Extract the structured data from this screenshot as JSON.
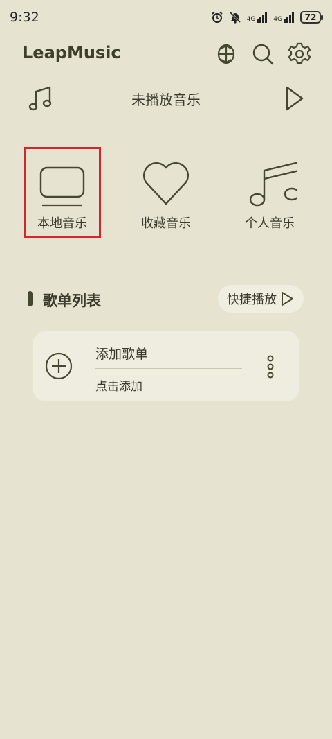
{
  "status_bar": {
    "time": "9:32",
    "network_1": "4G",
    "network_2": "4G",
    "battery": "72",
    "icons": [
      "alarm-icon",
      "mute-icon",
      "signal-icon",
      "signal-icon",
      "battery-icon"
    ]
  },
  "header": {
    "app_title": "LeapMusic",
    "icons": [
      "equalizer-icon",
      "search-icon",
      "settings-gear-icon"
    ]
  },
  "now_playing": {
    "title": "未播放音乐",
    "icons": [
      "music-note-icon",
      "play-icon"
    ]
  },
  "categories": [
    {
      "label": "本地音乐",
      "icon": "local-music-monitor-icon"
    },
    {
      "label": "收藏音乐",
      "icon": "heart-icon"
    },
    {
      "label": "个人音乐",
      "icon": "music-notes-icon"
    }
  ],
  "playlist_section": {
    "title": "歌单列表",
    "quick_play_label": "快捷播放",
    "card": {
      "title": "添加歌单",
      "subtitle": "点击添加",
      "icons": [
        "add-circle-icon",
        "more-vertical-icon"
      ]
    }
  },
  "colors": {
    "background": "#e6e3d0",
    "card": "#efede0",
    "text": "#3b3a2c",
    "highlight": "#d6242a"
  }
}
